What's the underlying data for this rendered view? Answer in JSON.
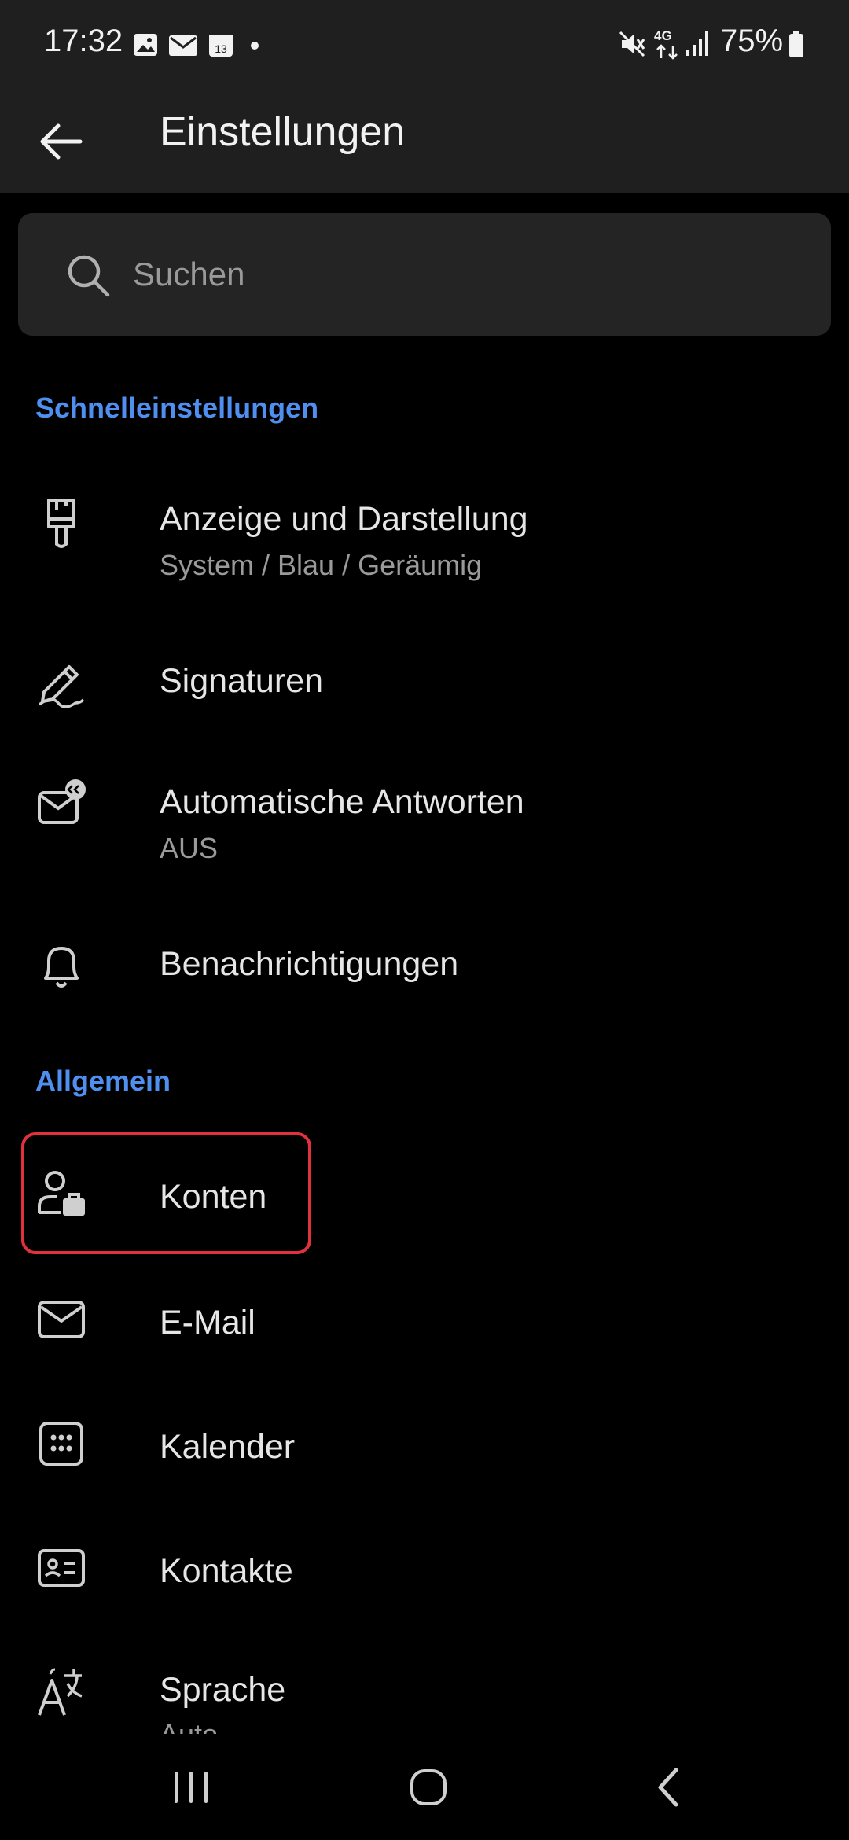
{
  "status_bar": {
    "time": "17:32",
    "calendar_day": "13",
    "network": "4G",
    "battery": "75%",
    "left_icons": [
      "gallery-icon",
      "mail-icon",
      "calendar-icon",
      "dot-icon"
    ],
    "right_icons": [
      "mute-icon",
      "4g-data-icon",
      "signal-icon",
      "battery-icon"
    ]
  },
  "app_bar": {
    "title": "Einstellungen",
    "back_icon": "arrow-left-icon"
  },
  "search": {
    "placeholder": "Suchen"
  },
  "sections": {
    "quick": {
      "header": "Schnelleinstellungen",
      "items": [
        {
          "title": "Anzeige und Darstellung",
          "subtitle": "System / Blau / Geräumig",
          "icon": "paintbrush-icon"
        },
        {
          "title": "Signaturen",
          "icon": "signature-pen-icon"
        },
        {
          "title": "Automatische Antworten",
          "subtitle": "AUS",
          "icon": "mail-reply-icon"
        },
        {
          "title": "Benachrichtigungen",
          "icon": "bell-icon"
        }
      ]
    },
    "general": {
      "header": "Allgemein",
      "items": [
        {
          "title": "Konten",
          "icon": "account-briefcase-icon"
        },
        {
          "title": "E-Mail",
          "icon": "envelope-icon"
        },
        {
          "title": "Kalender",
          "icon": "calendar-grid-icon"
        },
        {
          "title": "Kontakte",
          "icon": "contact-card-icon"
        },
        {
          "title": "Sprache",
          "subtitle": "Auto",
          "icon": "language-icon"
        }
      ]
    }
  },
  "nav_bar": {
    "buttons": [
      "recents-icon",
      "home-icon",
      "back-icon"
    ]
  },
  "colors": {
    "accent": "#4f8ff0",
    "highlight": "#e0313d",
    "background": "#000000",
    "surface": "#1f1f1f"
  }
}
